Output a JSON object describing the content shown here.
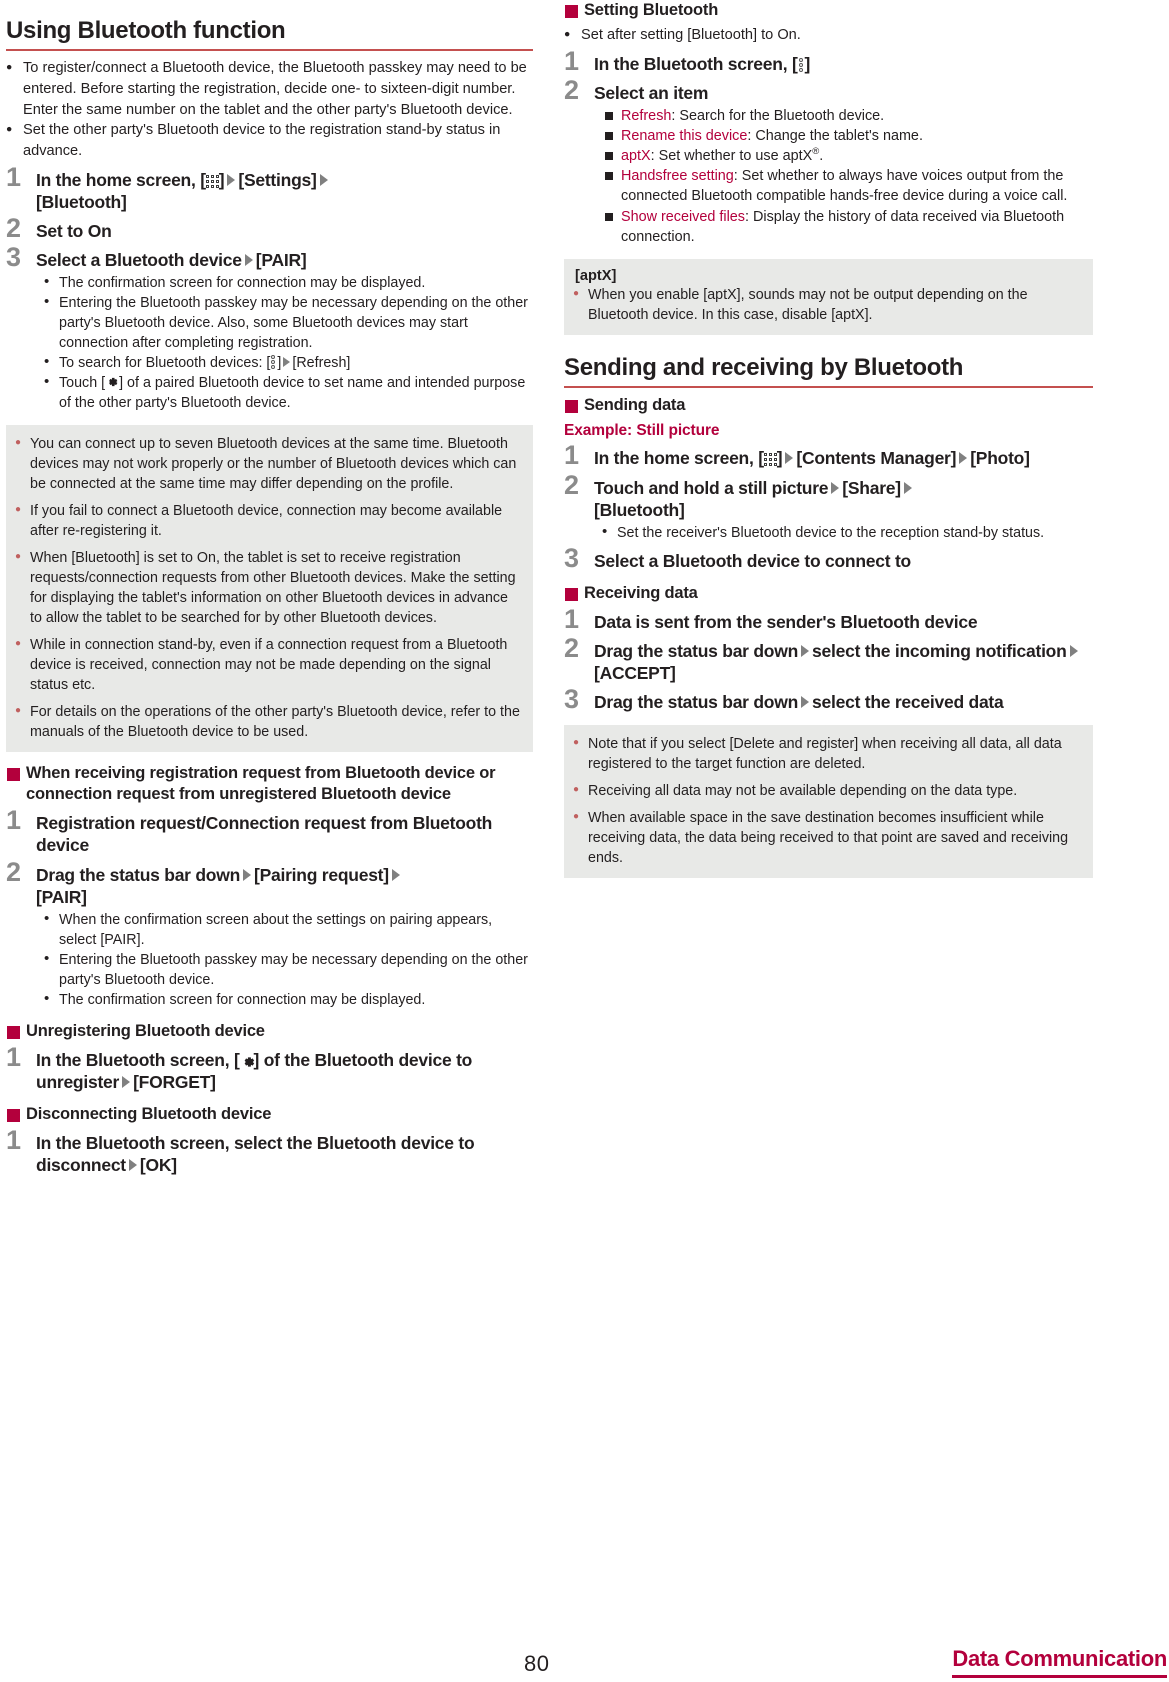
{
  "left": {
    "chapter_title": "Using Bluetooth function",
    "intro_bullets": [
      "To register/connect a Bluetooth device, the Bluetooth passkey may need to be entered. Before starting the registration, decide one- to sixteen-digit number. Enter the same number on the tablet and the other party's Bluetooth device.",
      "Set the other party's Bluetooth device to the registration stand-by status in advance."
    ],
    "step1": {
      "num": "1",
      "a": "In the home screen, [",
      "b": "]",
      "c": "[Settings]",
      "d": "[Bluetooth]"
    },
    "step2": {
      "num": "2",
      "text": "Set to On"
    },
    "step3": {
      "num": "3",
      "a": "Select a Bluetooth device",
      "b": "[PAIR]"
    },
    "step3_subs": {
      "s1": "The confirmation screen for connection may be displayed.",
      "s2": "Entering the Bluetooth passkey may be necessary depending on the other party's Bluetooth device. Also, some Bluetooth devices may start connection after completing registration.",
      "s3_a": "To search for Bluetooth devices: [",
      "s3_b": "]",
      "s3_c": "[Refresh]",
      "s4_a": "Touch [",
      "s4_b": "] of a paired Bluetooth device to set name and intended purpose of the other party's Bluetooth device."
    },
    "note1": [
      "You can connect up to seven Bluetooth devices at the same time. Bluetooth devices may not work properly or the number of Bluetooth devices which can be connected at the same time may differ depending on the profile.",
      "If you fail to connect a Bluetooth device, connection may become available after re-registering it.",
      "When [Bluetooth] is set to On, the tablet is set to receive registration requests/connection requests from other Bluetooth devices. Make the setting for displaying the tablet's information on other Bluetooth devices in advance to allow the tablet to be searched for by other Bluetooth devices.",
      "While in connection stand-by, even if a connection request from a Bluetooth device is received, connection may not be made depending on the signal status etc.",
      "For details on the operations of the other party's Bluetooth device, refer to the manuals of the Bluetooth device to be used."
    ],
    "sec_receiving_request": "When receiving registration request from Bluetooth device or connection request from unregistered Bluetooth device",
    "rr_step1": {
      "num": "1",
      "text": "Registration request/Connection request from Bluetooth device"
    },
    "rr_step2": {
      "num": "2",
      "a": "Drag the status bar down",
      "b": "[Pairing request]",
      "c": "[PAIR]"
    },
    "rr_subs": [
      "When the confirmation screen about the settings on pairing appears, select [PAIR].",
      "Entering the Bluetooth passkey may be necessary depending on the other party's Bluetooth device.",
      "The confirmation screen for connection may be displayed."
    ],
    "sec_unregister": "Unregistering Bluetooth device",
    "un_step1": {
      "num": "1",
      "a": "In the Bluetooth screen, [",
      "b": "] of the Bluetooth device to unregister",
      "c": "[FORGET]"
    },
    "sec_disconnect": "Disconnecting Bluetooth device",
    "dc_step1": {
      "num": "1",
      "a": "In the Bluetooth screen, select the Bluetooth device to disconnect",
      "b": "[OK]"
    }
  },
  "right": {
    "sec_setting": "Setting Bluetooth",
    "setting_bullet": "Set after setting [Bluetooth] to On.",
    "set_step1": {
      "num": "1",
      "a": "In the Bluetooth screen, [",
      "b": "]"
    },
    "set_step2": {
      "num": "2",
      "text": "Select an item"
    },
    "menu_items": [
      {
        "key": "Refresh",
        "desc": ": Search for the Bluetooth device."
      },
      {
        "key": "Rename this device",
        "desc": ": Change the tablet's name."
      },
      {
        "key": "aptX",
        "desc_a": ": Set whether to use aptX",
        "sup": "®",
        "desc_b": "."
      },
      {
        "key": "Handsfree setting",
        "desc": ": Set whether to always have voices output from the connected Bluetooth compatible hands-free device during a voice call."
      },
      {
        "key": "Show received files",
        "desc": ": Display the history of data received via Bluetooth connection."
      }
    ],
    "aptx_note_title": "[aptX]",
    "aptx_note_body": "When you enable [aptX], sounds may not be output depending on the Bluetooth device. In this case, disable [aptX].",
    "chapter_title2": "Sending and receiving by Bluetooth",
    "sec_sending": "Sending data",
    "example_head": "Example: Still picture",
    "snd_step1": {
      "num": "1",
      "a": "In the home screen, [",
      "b": "]",
      "c": "[Contents Manager]",
      "d": "[Photo]"
    },
    "snd_step2": {
      "num": "2",
      "a": "Touch and hold a still picture",
      "b": "[Share]",
      "c": "[Bluetooth]"
    },
    "snd_step2_sub": "Set the receiver's Bluetooth device to the reception stand-by status.",
    "snd_step3": {
      "num": "3",
      "text": "Select a Bluetooth device to connect to"
    },
    "sec_receiving": "Receiving data",
    "rcv_step1": {
      "num": "1",
      "text": "Data is sent from the sender's Bluetooth device"
    },
    "rcv_step2": {
      "num": "2",
      "a": "Drag the status bar down",
      "b": "select the incoming notification",
      "c": "[ACCEPT]"
    },
    "rcv_step3": {
      "num": "3",
      "a": "Drag the status bar down",
      "b": "select the received data"
    },
    "note2": [
      "Note that if you select [Delete and register] when receiving all data, all data registered to the target function are deleted.",
      "Receiving all data may not be available depending on the data type.",
      "When available space in the save destination becomes insufficient while receiving data, the data being received to that point are saved and receiving ends."
    ]
  },
  "footer": {
    "page_number": "80",
    "section_tab": "Data Communication"
  },
  "colors": {
    "accent_crimson": "#b3003c",
    "rule_red": "#c4504f",
    "note_bg": "#e8e9e7",
    "note_bullet": "#c0605f",
    "step_number": "#8b8b8b",
    "text": "#231f20"
  }
}
